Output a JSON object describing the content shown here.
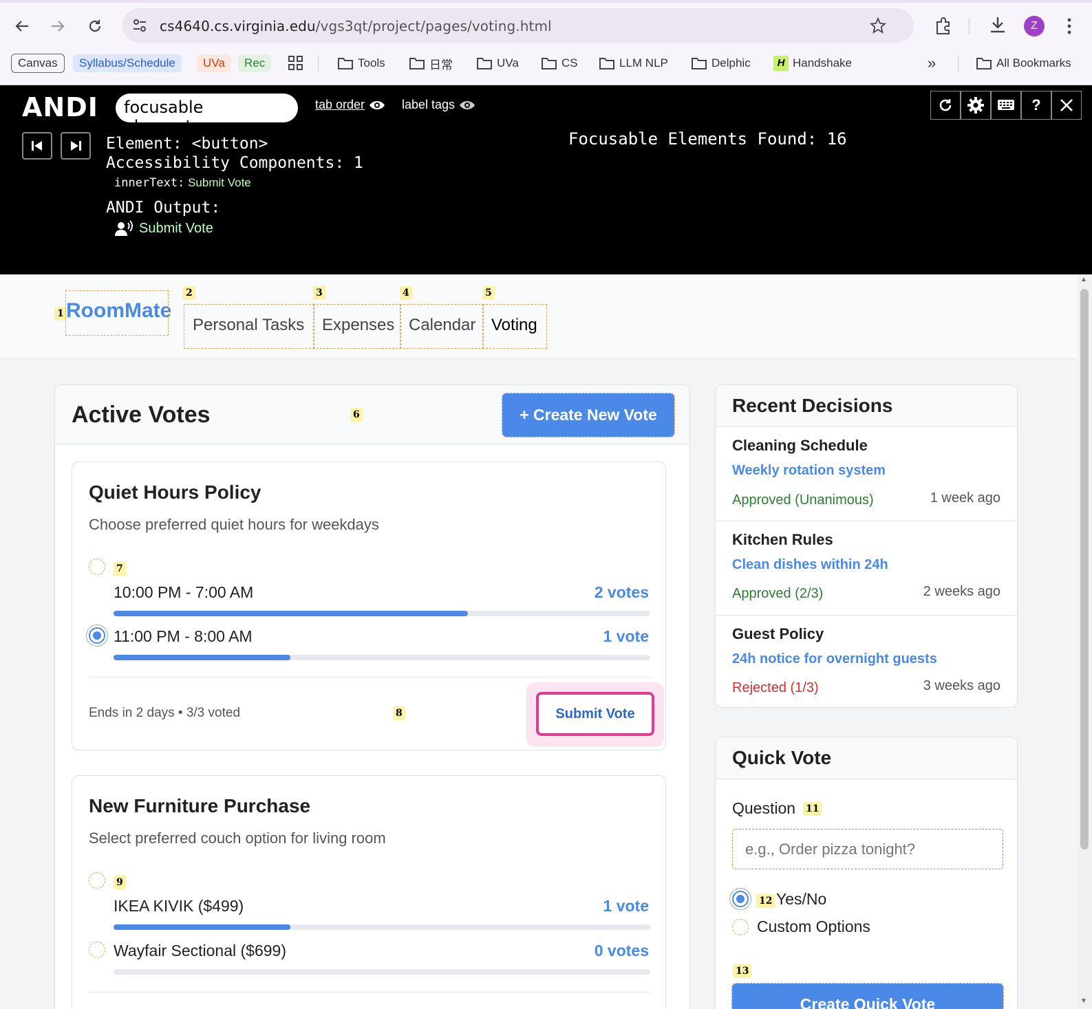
{
  "browser": {
    "url_domain": "cs4640.cs.virginia.edu",
    "url_path": "/vgs3qt/project/pages/voting.html",
    "avatar_letter": "Z",
    "bookmarks": [
      {
        "label": "Canvas"
      },
      {
        "label": "Syllabus/Schedule"
      },
      {
        "label": "UVa"
      },
      {
        "label": "Rec"
      },
      {
        "label": "Tools"
      },
      {
        "label": "日常"
      },
      {
        "label": "UVa"
      },
      {
        "label": "CS"
      },
      {
        "label": "LLM NLP"
      },
      {
        "label": "Delphic"
      },
      {
        "label": "Handshake"
      }
    ],
    "overflow": "»",
    "all_bookmarks": "All Bookmarks"
  },
  "andi": {
    "logo": "ANDI",
    "mode": "focusable elements",
    "tab_order": "tab order",
    "label_tags": "label tags",
    "element_label": "Element: <button>",
    "components_label": "Accessibility Components: 1",
    "inner_key": "innerText:",
    "inner_value": "Submit Vote",
    "output_label": "ANDI Output:",
    "output_value": "Submit Vote",
    "found": "Focusable Elements Found: 16",
    "help": "?"
  },
  "nav": {
    "brand": "RoomMate",
    "links": [
      "Personal Tasks",
      "Expenses",
      "Calendar",
      "Voting"
    ],
    "badges": [
      "1",
      "2",
      "3",
      "4",
      "5"
    ]
  },
  "active_votes": {
    "title": "Active Votes",
    "badge": "6",
    "create_button": "+ Create New Vote",
    "votes": [
      {
        "title": "Quiet Hours Policy",
        "description": "Choose preferred quiet hours for weekdays",
        "options": [
          {
            "label": "10:00 PM - 7:00 AM",
            "votes": "2 votes",
            "share": 0.66,
            "selected": false,
            "badge": "7"
          },
          {
            "label": "11:00 PM - 8:00 AM",
            "votes": "1 vote",
            "share": 0.33,
            "selected": true
          }
        ],
        "footer": "Ends in 2 days • 3/3 voted",
        "footer_badge": "8",
        "submit": "Submit Vote"
      },
      {
        "title": "New Furniture Purchase",
        "description": "Select preferred couch option for living room",
        "options": [
          {
            "label": "IKEA KIVIK ($499)",
            "votes": "1 vote",
            "share": 0.33,
            "selected": false,
            "badge": "9"
          },
          {
            "label": "Wayfair Sectional ($699)",
            "votes": "0 votes",
            "share": 0,
            "selected": false
          }
        ]
      }
    ]
  },
  "recent": {
    "title": "Recent Decisions",
    "items": [
      {
        "title": "Cleaning Schedule",
        "sub": "Weekly rotation system",
        "status": "Approved (Unanimous)",
        "time": "1 week ago",
        "status_color": "#2e7d32"
      },
      {
        "title": "Kitchen Rules",
        "sub": "Clean dishes within 24h",
        "status": "Approved (2/3)",
        "time": "2 weeks ago",
        "status_color": "#2e7d32"
      },
      {
        "title": "Guest Policy",
        "sub": "24h notice for overnight guests",
        "status": "Rejected (1/3)",
        "time": "3 weeks ago",
        "status_color": "#d32f2f"
      }
    ]
  },
  "quick_vote": {
    "title": "Quick Vote",
    "question_label": "Question",
    "question_badge": "11",
    "placeholder": "e.g., Order pizza tonight?",
    "option_yes": "Yes/No",
    "option_yes_badge": "12",
    "option_custom": "Custom Options",
    "create_badge": "13",
    "create_button": "Create Quick Vote"
  },
  "colors": {
    "accent": "#4a89e8",
    "focus": "#e23c92",
    "andi_bg": "#000000"
  }
}
